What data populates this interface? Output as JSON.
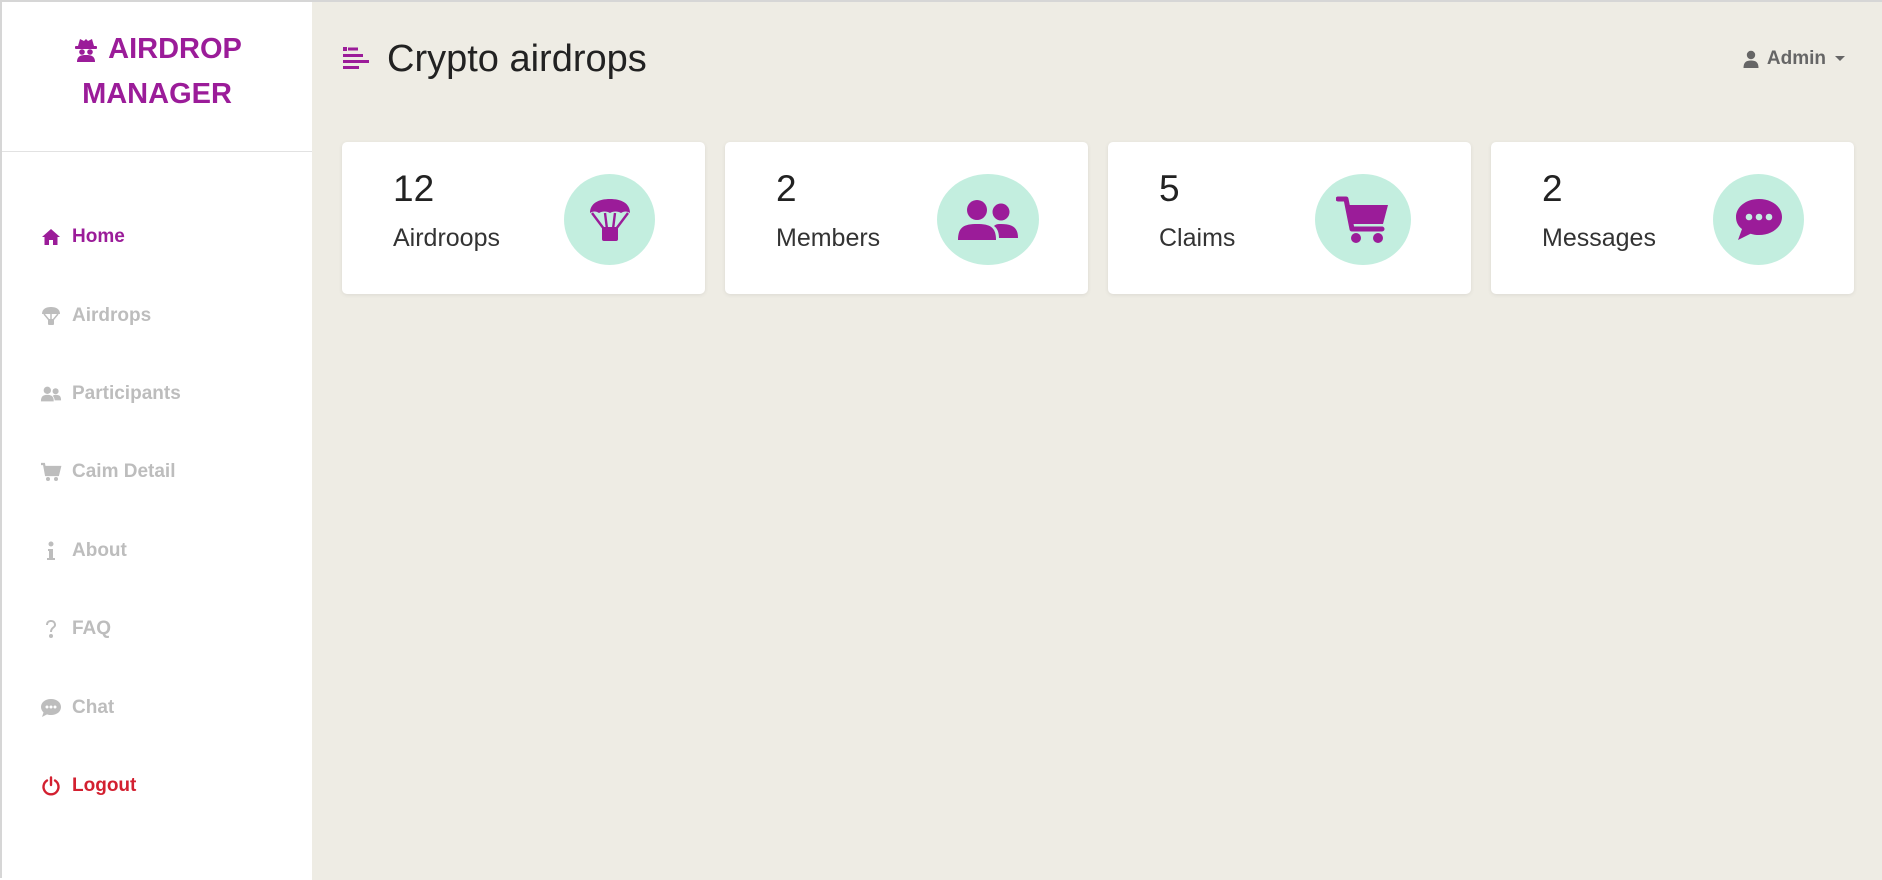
{
  "brand": {
    "line1": "AIRDROP",
    "line2": "MANAGER",
    "color": "#9b1c99"
  },
  "sidebar": {
    "items": [
      {
        "label": "Home",
        "icon": "home-icon",
        "state": "active"
      },
      {
        "label": "Airdrops",
        "icon": "parachute-icon",
        "state": "inactive"
      },
      {
        "label": "Participants",
        "icon": "users-icon",
        "state": "inactive"
      },
      {
        "label": "Caim Detail",
        "icon": "cart-icon",
        "state": "inactive"
      },
      {
        "label": "About",
        "icon": "info-icon",
        "state": "inactive"
      },
      {
        "label": "FAQ",
        "icon": "question-icon",
        "state": "inactive"
      },
      {
        "label": "Chat",
        "icon": "chat-icon",
        "state": "inactive"
      },
      {
        "label": "Logout",
        "icon": "power-icon",
        "state": "danger"
      }
    ]
  },
  "header": {
    "title": "Crypto airdrops",
    "user": "Admin"
  },
  "stats": [
    {
      "count": "12",
      "label": "Airdroops",
      "icon": "parachute-icon"
    },
    {
      "count": "2",
      "label": "Members",
      "icon": "users-icon"
    },
    {
      "count": "5",
      "label": "Claims",
      "icon": "cart-icon"
    },
    {
      "count": "2",
      "label": "Messages",
      "icon": "chat-icon"
    }
  ],
  "colors": {
    "accent": "#9b1c99",
    "icon_bg": "#c3eedf",
    "danger": "#d32030",
    "muted": "#bdbdbd",
    "main_bg": "#eeece4"
  }
}
